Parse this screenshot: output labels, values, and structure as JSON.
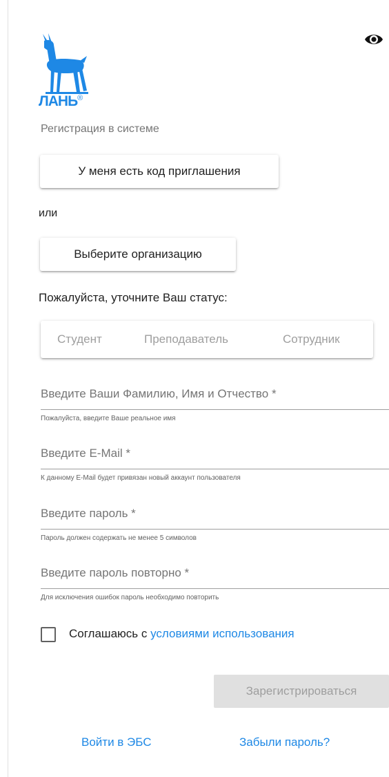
{
  "header": {
    "eye_icon": "eye-icon",
    "logo_text": "ЛАНЬ",
    "registered_mark": "®",
    "logo_color": "#1e88e5"
  },
  "registration": {
    "subtitle": "Регистрация в системе",
    "invite_button": "У меня есть код приглашения",
    "or_text": "или",
    "org_button": "Выберите организацию",
    "status_label": "Пожалуйста, уточните Ваш статус:",
    "status_options": [
      "Студент",
      "Преподаватель",
      "Сотрудник"
    ]
  },
  "fields": [
    {
      "placeholder": "Введите Ваши Фамилию, Имя и Отчество *",
      "hint": "Пожалуйста, введите Ваше реальное имя",
      "value": ""
    },
    {
      "placeholder": "Введите E-Mail *",
      "hint": "К данному E-Mail будет привязан новый аккаунт пользователя",
      "value": ""
    },
    {
      "placeholder": "Введите пароль *",
      "hint": "Пароль должен содержать не менее 5 символов",
      "value": ""
    },
    {
      "placeholder": "Введите пароль повторно *",
      "hint": "Для исключения ошибок пароль необходимо повторить",
      "value": ""
    }
  ],
  "agreement": {
    "prefix": "Соглашаюсь с",
    "link": "условиями использования",
    "checked": false
  },
  "actions": {
    "register": "Зарегистрироваться",
    "login": "Войти в ЭБС",
    "forgot": "Забыли пароль?"
  },
  "colors": {
    "accent": "#1e88e5",
    "disabled_bg": "#e0e0e0",
    "disabled_text": "#9e9e9e"
  }
}
